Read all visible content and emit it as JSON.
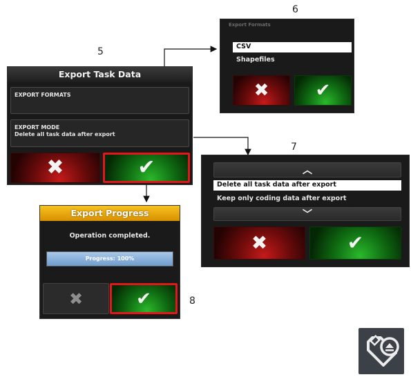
{
  "steps": {
    "s5": "5",
    "s6": "6",
    "s7": "7",
    "s8": "8"
  },
  "export_task_data": {
    "title": "Export Task Data",
    "formats_label": "EXPORT FORMATS",
    "mode_label": "EXPORT MODE",
    "mode_value": "Delete all task data after export",
    "cancel_icon": "x-icon",
    "confirm_icon": "check-icon"
  },
  "formats_popup": {
    "header": "Export Formats",
    "options": [
      "CSV",
      "Shapefiles"
    ],
    "selected": "CSV"
  },
  "mode_popup": {
    "options": [
      "Delete all task data after export",
      "Keep only coding data after export"
    ],
    "selected": "Delete all task data after export"
  },
  "export_progress": {
    "title": "Export Progress",
    "status": "Operation completed.",
    "progress_text": "Progress: 100%",
    "progress_value": 100
  },
  "colors": {
    "title_bar_progress": "#e0a000",
    "highlight": "#e3171a",
    "confirm": "#138a16",
    "cancel": "#a01212"
  },
  "icons": {
    "device": "usb-tag-eject-icon"
  }
}
